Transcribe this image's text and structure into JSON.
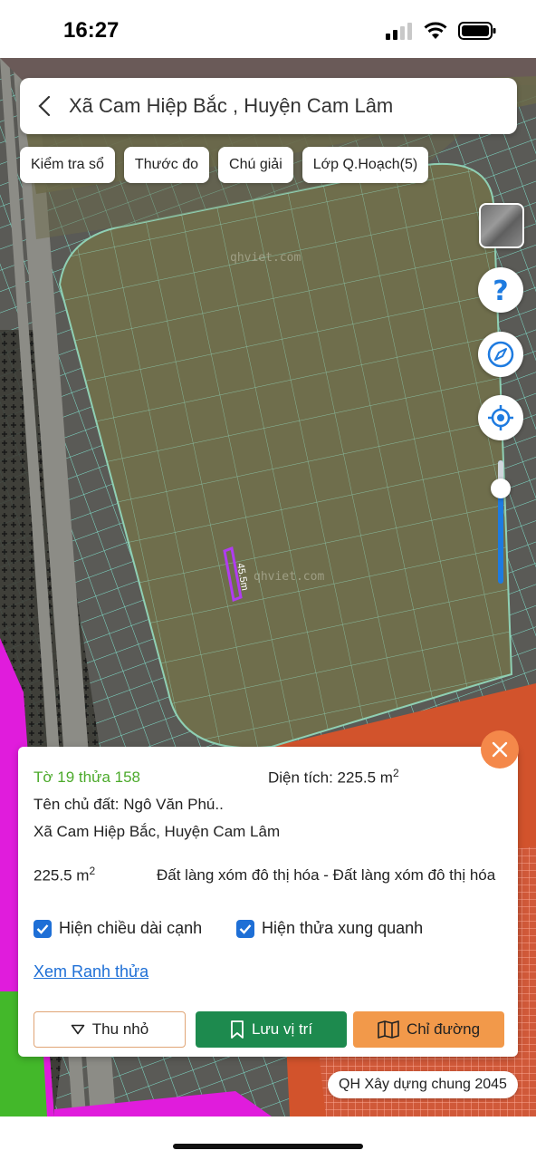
{
  "status": {
    "time": "16:27"
  },
  "header": {
    "title": "Xã Cam Hiệp Bắc , Huyện Cam Lâm"
  },
  "chips": [
    "Kiểm tra sổ",
    "Thước đo",
    "Chú giải",
    "Lớp Q.Hoạch(5)"
  ],
  "map": {
    "watermark": "qhviet.com",
    "parcel_edge_label": "45.5m",
    "zoom_level_fraction": 0.85
  },
  "panel": {
    "parcel_id": "Tờ 19 thửa 158",
    "area_label": "Diện tích: 225.5 m",
    "area_sup": "2",
    "owner": "Tên chủ đất: Ngô Văn Phú..",
    "location": "Xã Cam Hiệp Bắc, Huyện Cam Lâm",
    "area_value": "225.5 m",
    "area_value_sup": "2",
    "land_type": "Đất làng xóm đô thị hóa - Đất làng xóm đô thị hóa",
    "check_edges": "Hiện chiều dài cạnh",
    "check_neighbors": "Hiện thửa xung quanh",
    "boundary_link": "Xem Ranh thửa",
    "btn_shrink": "Thu nhỏ",
    "btn_save": "Lưu vị trí",
    "btn_directions": "Chỉ đường"
  },
  "plan_label": "QH Xây dựng chung 2045",
  "colors": {
    "accent_blue": "#1e6fd6",
    "save_green": "#1d8a4e",
    "direction_orange": "#f2994a",
    "close_orange": "#f4884a",
    "parcel_id_green": "#4caa2b"
  }
}
